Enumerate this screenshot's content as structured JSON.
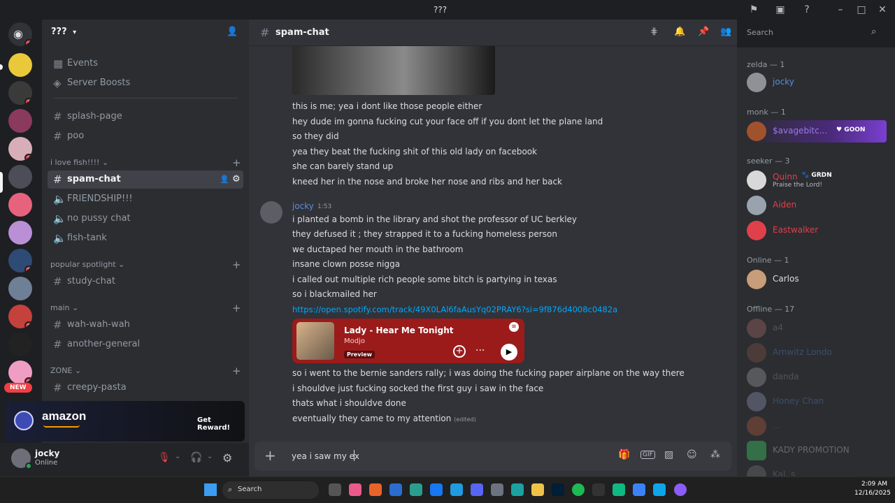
{
  "window": {
    "title": "???"
  },
  "server": {
    "name": "???"
  },
  "rail": {
    "badges": [
      "3",
      "1",
      "2",
      "2",
      "2",
      "2"
    ],
    "new_label": "NEW"
  },
  "sidebar": {
    "top_items": [
      {
        "label": "Events",
        "icon": "calendar-icon"
      },
      {
        "label": "Server Boosts",
        "icon": "boost-icon"
      }
    ],
    "channels_a": [
      {
        "label": "splash-page",
        "type": "text"
      },
      {
        "label": "poo",
        "type": "text"
      }
    ],
    "category_fish": "i love fish!!!!",
    "channels_fish": [
      {
        "label": "spam-chat",
        "type": "text",
        "active": true
      },
      {
        "label": "FRIENDSHIP!!!",
        "type": "voice"
      },
      {
        "label": "no pussy chat",
        "type": "voice"
      },
      {
        "label": "fish-tank",
        "type": "voice"
      }
    ],
    "category_popular": "popular spotlight",
    "channels_popular": [
      {
        "label": "study-chat",
        "type": "text"
      }
    ],
    "category_main": "main",
    "channels_main": [
      {
        "label": "wah-wah-wah",
        "type": "text"
      },
      {
        "label": "another-general",
        "type": "text"
      }
    ],
    "category_zone": "ZONE",
    "channels_zone": [
      {
        "label": "creepy-pasta",
        "type": "text"
      }
    ]
  },
  "promo": {
    "brand": "amazon",
    "cta": "Get Reward!"
  },
  "user": {
    "name": "jocky",
    "status": "Online"
  },
  "channel": {
    "name": "spam-chat"
  },
  "messages": {
    "first_group": [
      "this is me; yea i dont like those people either",
      "hey dude im gonna fucking cut your face off if you dont let the plane land",
      "so they did",
      "yea they beat the fucking shit of this old lady on facebook",
      "she can barely stand up",
      "kneed her in the nose and broke her nose and ribs and her back"
    ],
    "second_group": {
      "author": "jocky",
      "time": "1:53",
      "lines": [
        "i planted a bomb in the library and shot the professor of UC berkley",
        "they defused it ; they strapped it to a fucking homeless person",
        "we ductaped her mouth in the bathroom",
        "insane clown posse nigga",
        "i called out multiple rich people some bitch is partying in texas",
        "so i blackmailed her"
      ],
      "link": "https://open.spotify.com/track/49X0LAl6faAusYq02PRAY6?si=9f876d4008c0482a",
      "embed": {
        "title": "Lady - Hear Me Tonight",
        "artist": "Modjo",
        "badge": "Preview"
      },
      "after_lines": [
        "so i went to the bernie sanders rally; i was doing the fucking paper airplane on the way there",
        "i shouldve just fucking socked the first guy i saw in the face",
        "thats what i shouldve done"
      ],
      "last_line": "eventually they came to my attention",
      "edited": "(edited)"
    }
  },
  "composer": {
    "value": "yea i saw my ex"
  },
  "search": {
    "placeholder": "Search"
  },
  "members": {
    "groups": [
      {
        "title": "zelda — 1",
        "members": [
          {
            "name": "jocky"
          }
        ]
      },
      {
        "title": "monk — 1",
        "members": [
          {
            "name": "$avagebitc...",
            "tag": "GOON"
          }
        ]
      },
      {
        "title": "seeker — 3",
        "members": [
          {
            "name": "Quinn",
            "tag": "GRDN",
            "activity": "Praise the Lord!"
          },
          {
            "name": "Aiden"
          },
          {
            "name": "Eastwalker"
          }
        ]
      },
      {
        "title": "Online — 1",
        "members": [
          {
            "name": "Carlos"
          }
        ]
      },
      {
        "title": "Offline — 17",
        "members": [
          {
            "name": "a4"
          },
          {
            "name": "Arnwitz Londo"
          },
          {
            "name": "danda"
          },
          {
            "name": "Honey Chan"
          },
          {
            "name": "..."
          },
          {
            "name": "KADY PROMOTION"
          },
          {
            "name": "Kal..s"
          }
        ]
      }
    ]
  },
  "taskbar": {
    "search": "Search",
    "time": "2:09 AM",
    "date": "12/16/2025"
  }
}
